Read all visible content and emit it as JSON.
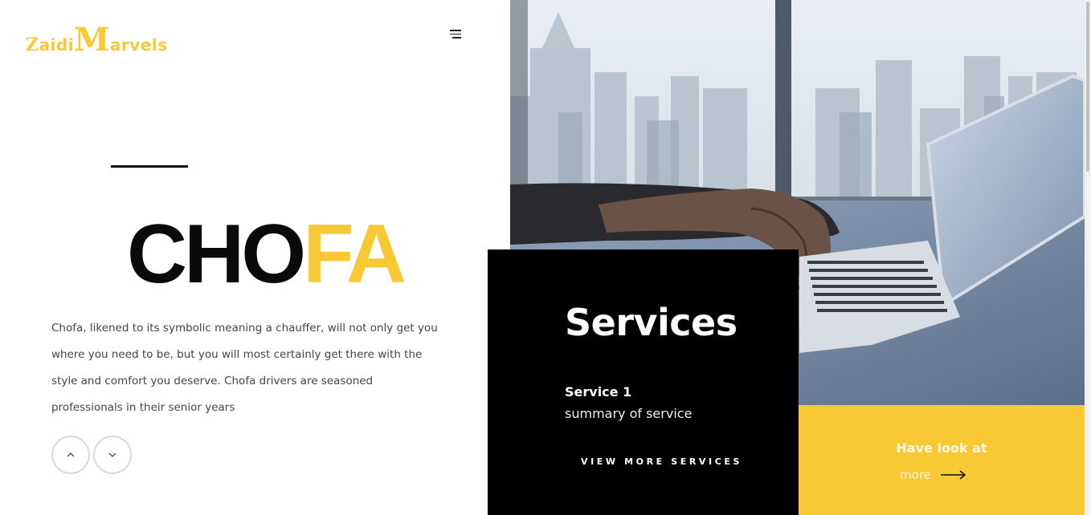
{
  "logo": {
    "part1_first": "Z",
    "part1_rest": "aidi",
    "part2_first": "M",
    "part2_rest": "arvels"
  },
  "hero": {
    "title_dark": "CHO",
    "title_yellow": "FA",
    "description": "Chofa, likened to its symbolic meaning a chauffer, will not only get you where you need to be, but you will most certainly get there with the style and comfort you deserve. Chofa drivers are seasoned professionals in their senior years"
  },
  "services": {
    "heading": "Services",
    "item_name": "Service 1",
    "item_summary": "summary of service",
    "view_more_label": "VIEW MORE SERVICES"
  },
  "promo": {
    "look_label": "Have look at",
    "more_label": "more"
  },
  "icons": {
    "menu": "hamburger-menu-icon",
    "up": "chevron-up-icon",
    "down": "chevron-down-icon",
    "arrow": "arrow-right-icon"
  },
  "colors": {
    "accent": "#f9c935",
    "dark": "#0a0a0a",
    "services_bg": "#000000"
  }
}
